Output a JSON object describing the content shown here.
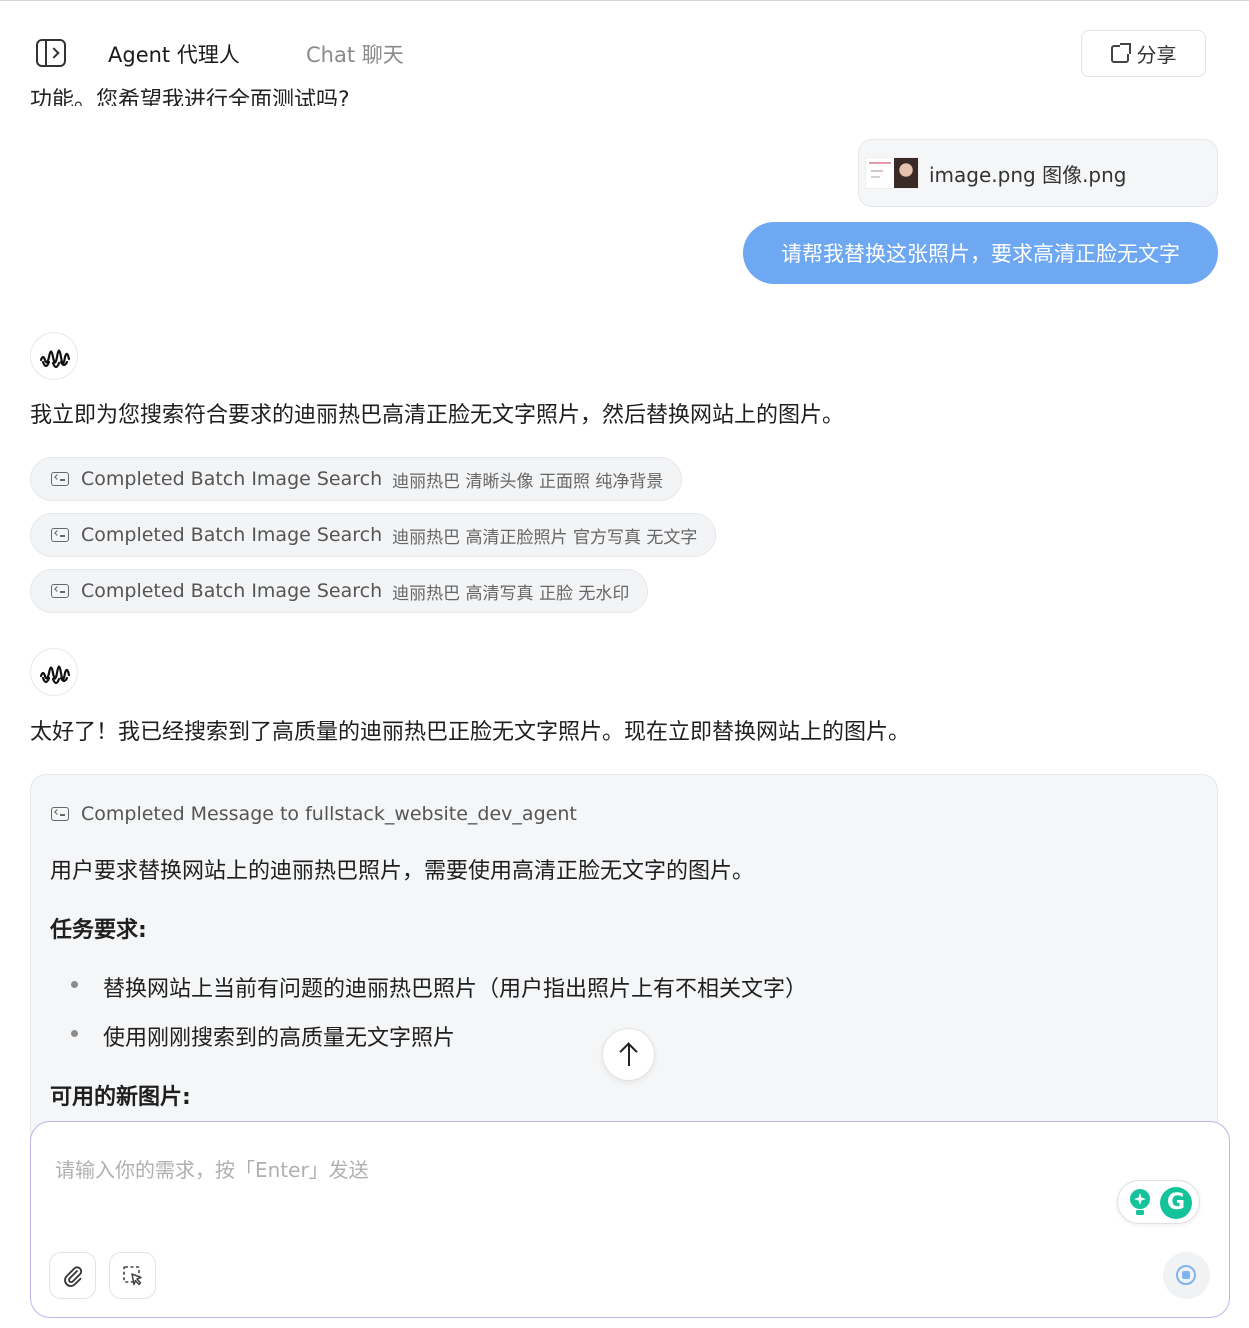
{
  "header": {
    "agent_tab": "Agent  代理人",
    "chat_tab": "Chat  聊天",
    "share_label": "分享"
  },
  "conversation": {
    "truncated_previous_text": "功能。您希望我进行全面测试吗?",
    "attachment": {
      "file_name": "image.png  图像.png"
    },
    "user_message": "请帮我替换这张照片，要求高清正脸无文字",
    "agent_message_1": "我立即为您搜索符合要求的迪丽热巴高清正脸无文字照片，然后替换网站上的图片。",
    "tool_calls": [
      {
        "label": "Completed Batch Image Search",
        "query": "迪丽热巴 清晰头像 正面照 纯净背景"
      },
      {
        "label": "Completed Batch Image Search",
        "query": "迪丽热巴 高清正脸照片 官方写真 无文字"
      },
      {
        "label": "Completed Batch Image Search",
        "query": "迪丽热巴 高清写真 正脸 无水印"
      }
    ],
    "agent_message_2": "太好了！我已经搜索到了高质量的迪丽热巴正脸无文字照片。现在立即替换网站上的图片。",
    "message_card": {
      "title": "Completed Message to fullstack_website_dev_agent",
      "paragraph": "用户要求替换网站上的迪丽热巴照片，需要使用高清正脸无文字的图片。",
      "requirements_heading": "任务要求:",
      "requirements": [
        "替换网站上当前有问题的迪丽热巴照片（用户指出照片上有不相关文字）",
        "使用刚刚搜索到的高质量无文字照片"
      ],
      "images_heading": "可用的新图片:"
    }
  },
  "input": {
    "placeholder": "请输入你的需求，按「Enter」发送",
    "value": ""
  },
  "icons": {
    "sidebar_toggle": "sidebar-toggle-icon",
    "share": "share-icon",
    "agent_avatar": "waveform-icon",
    "tool": "tool-icon",
    "scroll_up": "arrow-up-icon",
    "attach": "paperclip-icon",
    "select": "selection-cursor-icon",
    "send": "record-stop-icon",
    "grammar": "grammarly-icon"
  },
  "colors": {
    "user_bubble": "#6ea7f2",
    "input_border": "#b9b6ee",
    "send_accent": "#7fb4f0",
    "grammarly_green": "#15c39a"
  }
}
